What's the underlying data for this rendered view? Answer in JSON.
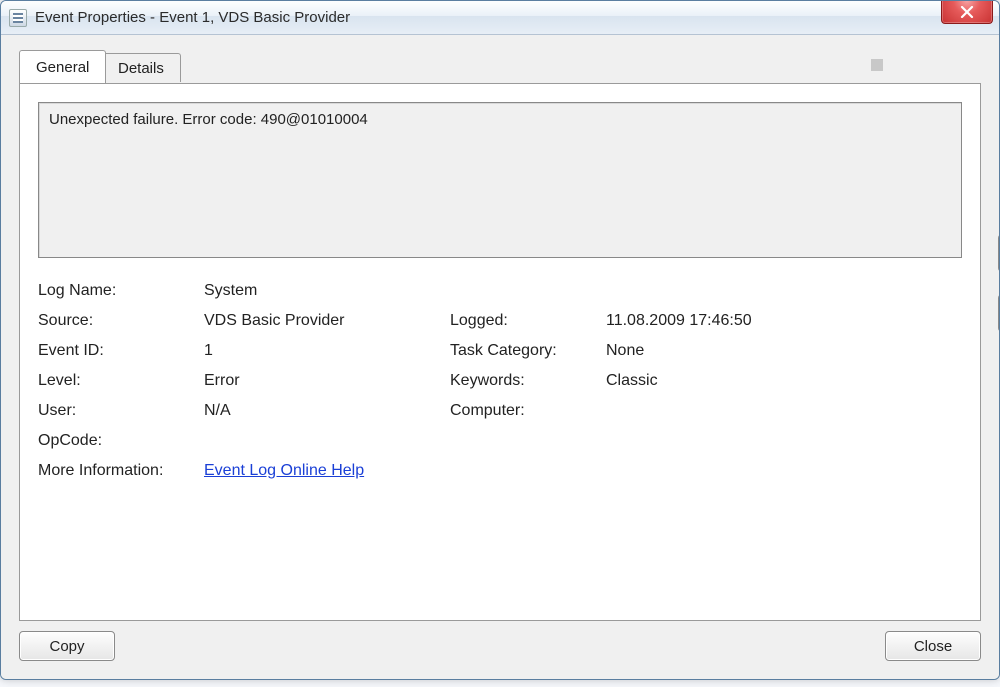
{
  "window": {
    "title": "Event Properties - Event 1, VDS Basic Provider"
  },
  "tabs": {
    "general": "General",
    "details": "Details"
  },
  "description": "Unexpected failure. Error code: 490@01010004",
  "fields": {
    "log_name_label": "Log Name:",
    "log_name_value": "System",
    "source_label": "Source:",
    "source_value": "VDS Basic Provider",
    "logged_label": "Logged:",
    "logged_value": "11.08.2009 17:46:50",
    "event_id_label": "Event ID:",
    "event_id_value": "1",
    "task_category_label": "Task Category:",
    "task_category_value": "None",
    "level_label": "Level:",
    "level_value": "Error",
    "keywords_label": "Keywords:",
    "keywords_value": "Classic",
    "user_label": "User:",
    "user_value": "N/A",
    "computer_label": "Computer:",
    "computer_value": "",
    "opcode_label": "OpCode:",
    "opcode_value": "",
    "more_info_label": "More Information:",
    "more_info_link": "Event Log Online Help"
  },
  "buttons": {
    "copy": "Copy",
    "close": "Close"
  }
}
